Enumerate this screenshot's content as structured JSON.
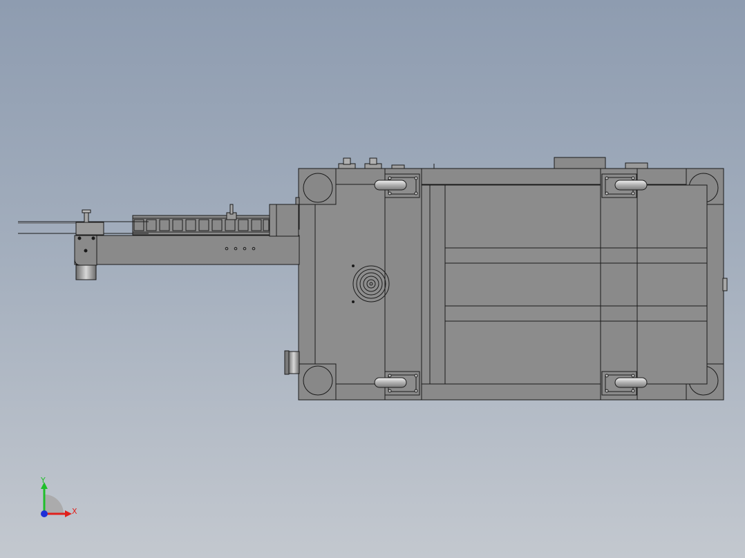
{
  "triad": {
    "x_label": "X",
    "y_label": "Y",
    "x_color": "#e0201c",
    "y_color": "#1fbf2a",
    "z_color": "#1f2fd8"
  },
  "colors": {
    "background_top": "#8e9cb0",
    "background_bottom": "#c3c8cf",
    "body_fill": "#8a8a8a",
    "edge": "#1a1a1a"
  }
}
